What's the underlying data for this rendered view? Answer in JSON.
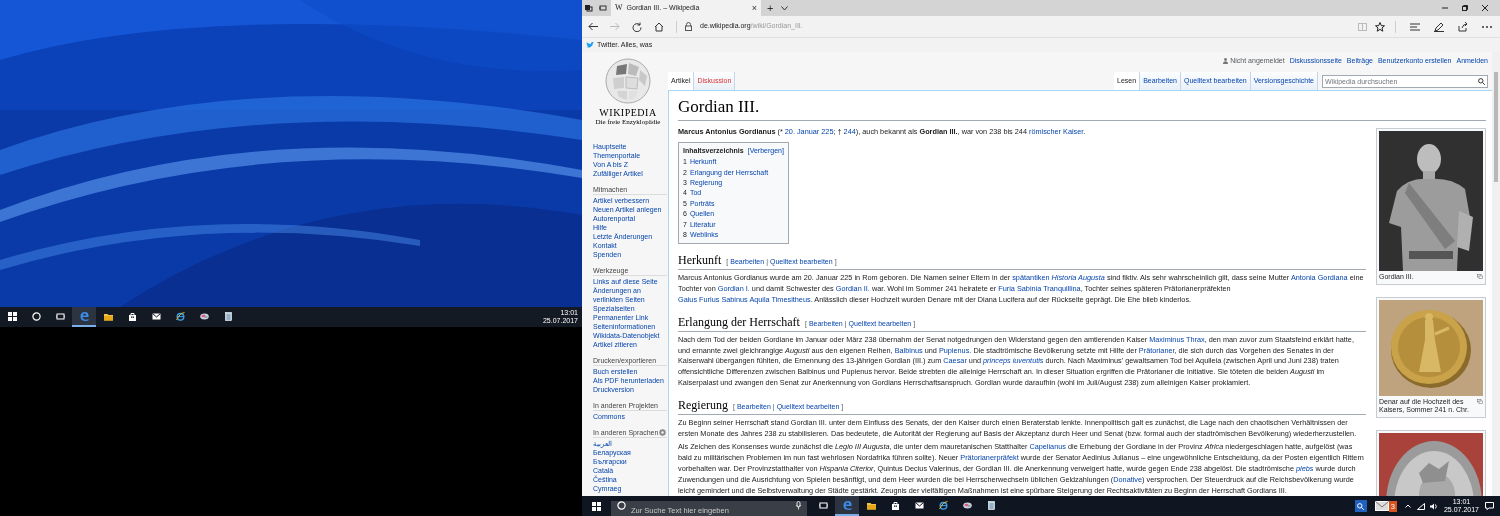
{
  "desktop": {
    "taskbar": {
      "items": [
        {
          "kind": "windows",
          "active": false
        },
        {
          "kind": "cortana",
          "active": false
        },
        {
          "kind": "taskview",
          "active": false
        },
        {
          "kind": "edge",
          "active": true
        },
        {
          "kind": "explorer",
          "active": false
        },
        {
          "kind": "store",
          "active": false
        },
        {
          "kind": "mail",
          "active": false
        },
        {
          "kind": "ie",
          "active": false
        },
        {
          "kind": "app",
          "active": false
        },
        {
          "kind": "notepad",
          "active": false
        }
      ],
      "time": "13:01",
      "date": "25.07.2017"
    }
  },
  "browser": {
    "tab": {
      "favicon": "W",
      "title": "Gordian III. – Wikipedia",
      "close": "×"
    },
    "new_tab": "+",
    "url": {
      "host": "de.wikipedia.org",
      "path": "/wiki/Gordian_III."
    },
    "favorites": [
      {
        "label": "Twitter. Alles, was"
      }
    ]
  },
  "wiki": {
    "logo": {
      "wordmark": "WIKIPEDIA",
      "tagline": "Die freie Enzyklopädie"
    },
    "sidebar": [
      {
        "items": [
          "Hauptseite",
          "Themenportale",
          "Von A bis Z",
          "Zufälliger Artikel"
        ]
      },
      {
        "heading": "Mitmachen",
        "items": [
          "Artikel verbessern",
          "Neuen Artikel anlegen",
          "Autorenportal",
          "Hilfe",
          "Letzte Änderungen",
          "Kontakt",
          "Spenden"
        ]
      },
      {
        "heading": "Werkzeuge",
        "items": [
          "Links auf diese Seite",
          "Änderungen an verlinkten Seiten",
          "Spezialseiten",
          "Permanenter Link",
          "Seiteninformationen",
          "Wikidata-Datenobjekt",
          "Artikel zitieren"
        ]
      },
      {
        "heading": "Drucken/exportieren",
        "items": [
          "Buch erstellen",
          "Als PDF herunterladen",
          "Druckversion"
        ]
      },
      {
        "heading": "In anderen Projekten",
        "items": [
          "Commons"
        ]
      },
      {
        "heading": "In anderen Sprachen",
        "settings": true,
        "items": [
          "العربية",
          "Беларуская",
          "Български",
          "Català",
          "Čeština",
          "Cymraeg"
        ]
      }
    ],
    "personal": [
      {
        "label": "Nicht angemeldet",
        "link": false
      },
      {
        "label": "Diskussionsseite",
        "link": true
      },
      {
        "label": "Beiträge",
        "link": true
      },
      {
        "label": "Benutzerkonto erstellen",
        "link": true
      },
      {
        "label": "Anmelden",
        "link": true
      }
    ],
    "namespaces": [
      {
        "label": "Artikel",
        "selected": true,
        "exists": true
      },
      {
        "label": "Diskussion",
        "selected": false,
        "exists": false
      }
    ],
    "views": [
      {
        "label": "Lesen",
        "selected": true
      },
      {
        "label": "Bearbeiten",
        "selected": false
      },
      {
        "label": "Quelltext bearbeiten",
        "selected": false
      },
      {
        "label": "Versionsgeschichte",
        "selected": false
      }
    ],
    "search": {
      "placeholder": "Wikipedia durchsuchen"
    },
    "title": "Gordian III.",
    "intro": [
      {
        "text": "**Marcus Antonius Gordianus** (* ",
        "link": false
      },
      {
        "text": "20. Januar 225",
        "link": true
      },
      {
        "text": "; † ",
        "link": false
      },
      {
        "text": "244",
        "link": true
      },
      {
        "text": "), auch bekannt als **Gordian III.**, war von 238 bis 244 ",
        "link": false
      },
      {
        "text": "römischer Kaiser",
        "link": true
      },
      {
        "text": "."
      }
    ],
    "toc": {
      "title": "Inhaltsverzeichnis",
      "toggle": "[Verbergen]",
      "items": [
        {
          "number": "1",
          "label": "Herkunft"
        },
        {
          "number": "2",
          "label": "Erlangung der Herrschaft"
        },
        {
          "number": "3",
          "label": "Regierung"
        },
        {
          "number": "4",
          "label": "Tod"
        },
        {
          "number": "5",
          "label": "Porträts"
        },
        {
          "number": "6",
          "label": "Quellen"
        },
        {
          "number": "7",
          "label": "Literatur"
        },
        {
          "number": "8",
          "label": "Weblinks"
        }
      ]
    },
    "sections": [
      {
        "heading": "Herkunft",
        "edit": {
          "open": "[",
          "links": [
            "Bearbeiten",
            "Quelltext bearbeiten"
          ],
          "separator": "|",
          "close": "]"
        },
        "paragraphs": [
          [
            {
              "text": "Marcus Antonius Gordianus wurde am 20. Januar 225 in Rom geboren. Die Namen seiner Eltern in der ",
              "link": false
            },
            {
              "text": "spätantiken *Historia Augusta*",
              "link": true
            },
            {
              "text": " sind fiktiv. Als sehr wahrscheinlich gilt, dass seine Mutter ",
              "link": false
            },
            {
              "text": "Antonia Gordiana",
              "link": true
            },
            {
              "text": " eine Tochter von ",
              "link": false
            },
            {
              "text": "Gordian I.",
              "link": true
            },
            {
              "text": " und damit Schwester des ",
              "link": false
            },
            {
              "text": "Gordian II.",
              "link": true
            },
            {
              "text": " war. Wohl im Sommer 241 heiratete er ",
              "link": false
            },
            {
              "text": "Furia Sabinia Tranquillina",
              "link": true
            },
            {
              "text": ", Tochter seines späteren Prätorianerpräfekten ",
              "link": false
            },
            {
              "text": "Gaius Furius Sabinus Aquila Timesitheus",
              "link": true
            },
            {
              "text": ". Anlässlich dieser Hochzeit wurden Denare mit der Diana Lucifera auf der Rückseite geprägt. Die Ehe blieb kinderlos.",
              "link": false
            }
          ]
        ]
      },
      {
        "heading": "Erlangung der Herrschaft",
        "edit": {
          "open": "[",
          "links": [
            "Bearbeiten",
            "Quelltext bearbeiten"
          ],
          "separator": "|",
          "close": "]"
        },
        "paragraphs": [
          [
            {
              "text": "Nach dem Tod der beiden Gordiane im Januar oder März 238 übernahm der Senat notgedrungen den Widerstand gegen den amtierenden Kaiser ",
              "link": false
            },
            {
              "text": "Maximinus Thrax",
              "link": true
            },
            {
              "text": ", den man zuvor zum Staatsfeind erklärt hatte, und ernannte zwei gleichrangige *Augusti* aus den eigenen Reihen, ",
              "link": false
            },
            {
              "text": "Balbinus",
              "link": true
            },
            {
              "text": " und ",
              "link": false
            },
            {
              "text": "Pupienus",
              "link": true
            },
            {
              "text": ". Die stadtrömische Bevölkerung setzte mit Hilfe der ",
              "link": false
            },
            {
              "text": "Prätorianer",
              "link": true
            },
            {
              "text": ", die sich durch das Vorgehen des Senates in der Kaiserwahl übergangen fühlten, die Ernennung des 13-jährigen Gordian (III.) zum ",
              "link": false
            },
            {
              "text": "Caesar",
              "link": true
            },
            {
              "text": " und ",
              "link": false
            },
            {
              "text": "*princeps iuventutis*",
              "link": true
            },
            {
              "text": " durch. Nach Maximinus' gewaltsamen Tod bei Aquileia (zwischen April und Juni 238) traten offensichtliche Differenzen zwischen Balbinus und Pupienus hervor. Beide strebten die alleinige Herrschaft an. In dieser Situation ergriffen die Prätorianer die Initiative. Sie töteten die beiden *Augusti* im Kaiserpalast und zwangen den Senat zur Anerkennung von Gordians Herrschaftsanspruch. Gordian wurde daraufhin (wohl im Juli/August 238) zum alleinigen Kaiser proklamiert.",
              "link": false
            }
          ]
        ]
      },
      {
        "heading": "Regierung",
        "edit": {
          "open": "[",
          "links": [
            "Bearbeiten",
            "Quelltext bearbeiten"
          ],
          "separator": "|",
          "close": "]"
        },
        "paragraphs": [
          [
            {
              "text": "Zu Beginn seiner Herrschaft stand Gordian III. unter dem Einfluss des Senats, der den Kaiser durch einen Beraterstab lenkte. Innenpolitisch galt es zunächst, die Lage nach den chaotischen Verhältnissen der ersten Monate des Jahres 238 zu stabilisieren. Das bedeutete, die Autorität der Regierung auf Basis der Akzeptanz durch Heer und Senat (bzw. formal auch der stadtrömischen Bevölkerung) wiederherzustellen.",
              "link": false
            }
          ],
          [
            {
              "text": "Als Zeichen des Konsenses wurde zunächst die *Legio III Augusta*, die unter dem mauretanischen Statthalter ",
              "link": false
            },
            {
              "text": "Capelianus",
              "link": true
            },
            {
              "text": " die Erhebung der Gordiane in der Provinz *Africa* niedergeschlagen hatte, aufgelöst (was bald zu militärischen Problemen im nun fast wehrlosen Nordafrika führen sollte). Neuer ",
              "link": false
            },
            {
              "text": "Prätorianerpräfekt",
              "link": true
            },
            {
              "text": " wurde der Senator Aedinius Julianus – eine ungewöhnliche Entscheidung, da der Posten eigentlich Rittern vorbehalten war. Der Provinzstatthalter von *Hispania Citerior*, Quintus Decius Valerinus, der Gordian III. die Anerkennung verweigert hatte, wurde gegen Ende 238 abgelöst. Die stadtrömische ",
              "link": false
            },
            {
              "text": "*plebs*",
              "link": true
            },
            {
              "text": " wurde durch Zuwendungen und die Ausrichtung von Spielen besänftigt, und dem Heer wurden die bei Herrscherwechseln üblichen Geldzahlungen (",
              "link": false
            },
            {
              "text": "Donative",
              "link": true
            },
            {
              "text": ") versprochen. Der Steuerdruck auf die Reichsbevölkerung wurde leicht gemindert und die Selbstverwaltung der Städte gestärkt. Zeugnis der vielfältigen Maßnahmen ist eine spürbare Steigerung der Rechtsaktivitäten zu Beginn der Herrschaft Gordians III.",
              "link": false
            }
          ]
        ]
      }
    ],
    "figures": [
      {
        "kind": "statue",
        "caption": "Gordian III."
      },
      {
        "kind": "coin",
        "caption": "Denar auf die Hochzeit des Kaisers, Sommer 241 n. Chr."
      },
      {
        "kind": "coin-red"
      }
    ]
  },
  "taskbar": {
    "search": {
      "placeholder": "Zur Suche Text hier eingeben"
    },
    "items": [
      {
        "kind": "taskview",
        "active": false
      },
      {
        "kind": "edge",
        "active": true
      },
      {
        "kind": "explorer",
        "active": false
      },
      {
        "kind": "store",
        "active": false
      },
      {
        "kind": "mail",
        "active": false
      },
      {
        "kind": "ie",
        "active": false
      },
      {
        "kind": "app",
        "active": false
      },
      {
        "kind": "notepad",
        "active": false
      }
    ],
    "mail_badge": "3",
    "time": "13:01",
    "date": "25.07.2017"
  }
}
